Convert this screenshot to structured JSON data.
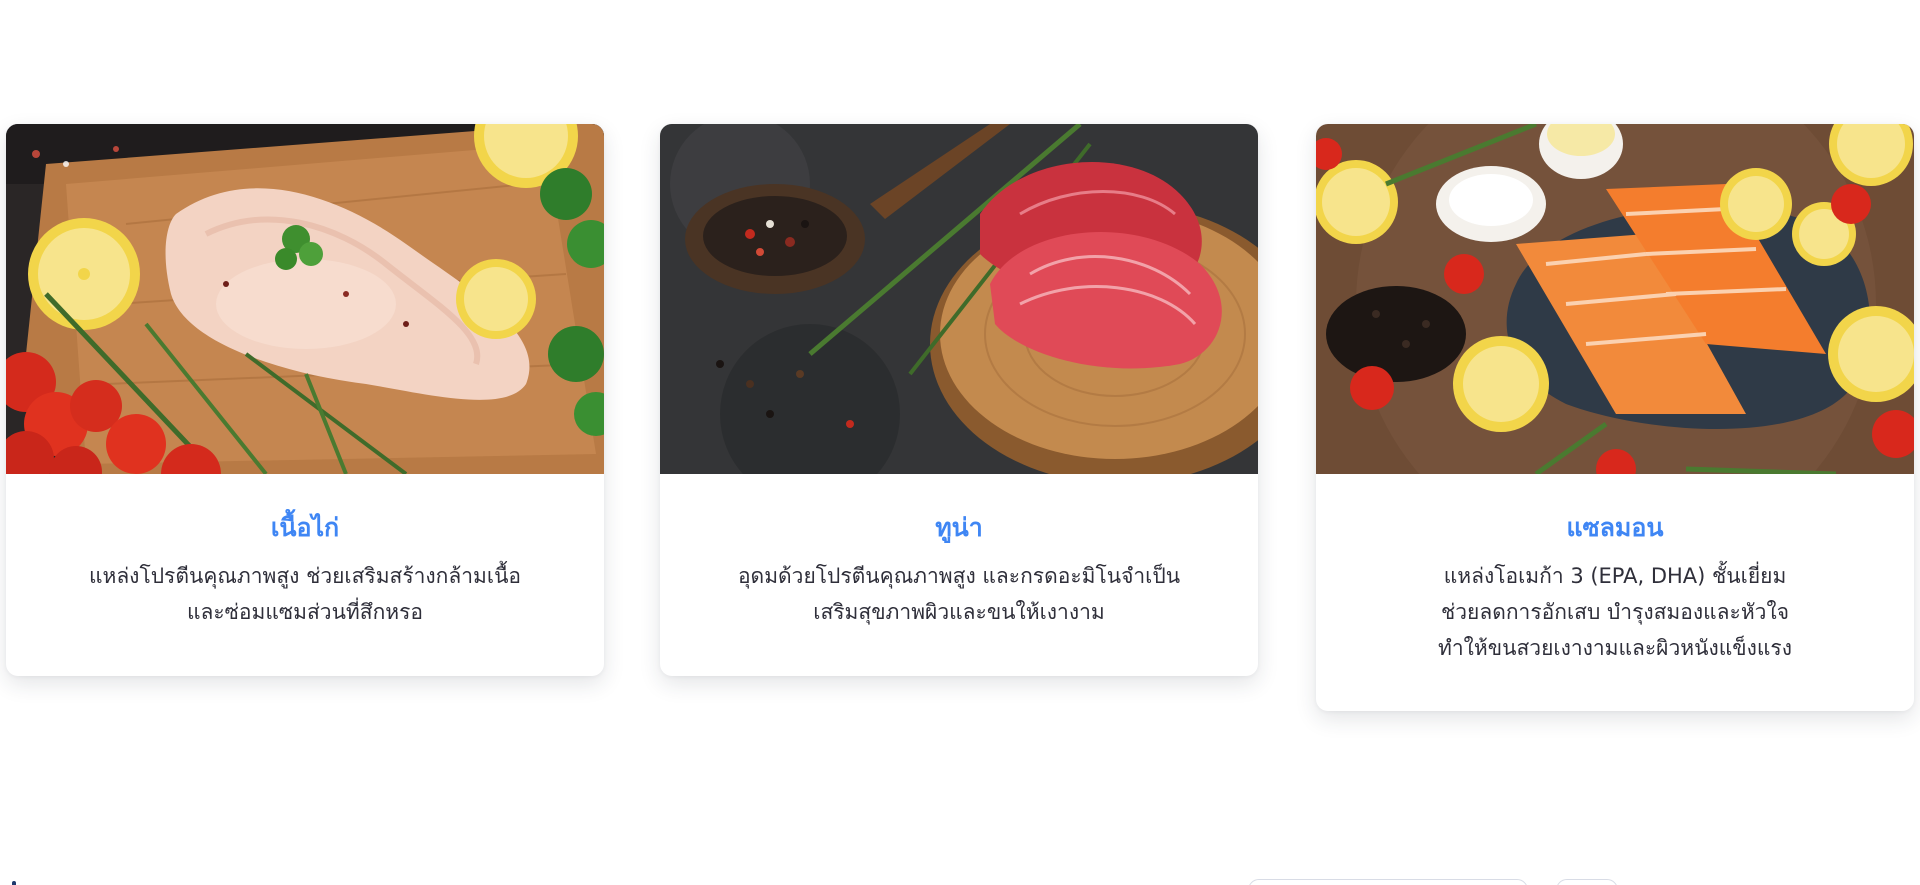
{
  "cards": [
    {
      "title": "เนื้อไก่",
      "image_alt": "chicken-breast-on-cutting-board",
      "lines": [
        "แหล่งโปรตีนคุณภาพสูง ช่วยเสริมสร้างกล้ามเนื้อ",
        "และซ่อมแซมส่วนที่สึกหรอ"
      ]
    },
    {
      "title": "ทูน่า",
      "image_alt": "tuna-steaks-on-wooden-board",
      "lines": [
        "อุดมด้วยโปรตีนคุณภาพสูง และกรดอะมิโนจำเป็น",
        "เสริมสุขภาพผิวและขนให้เงางาม"
      ]
    },
    {
      "title": "แซลมอน",
      "image_alt": "salmon-fillets-on-slate",
      "lines": [
        "แหล่งโอเมก้า 3 (EPA, DHA) ชั้นเยี่ยม",
        "ช่วยลดการอักเสบ บำรุงสมองและหัวใจ",
        "ทำให้ขนสวยเงางามและผิวหนังแข็งแรง"
      ]
    }
  ],
  "colors": {
    "title": "#3f86f4",
    "text": "#2f2f3a",
    "card_bg": "#ffffff"
  }
}
